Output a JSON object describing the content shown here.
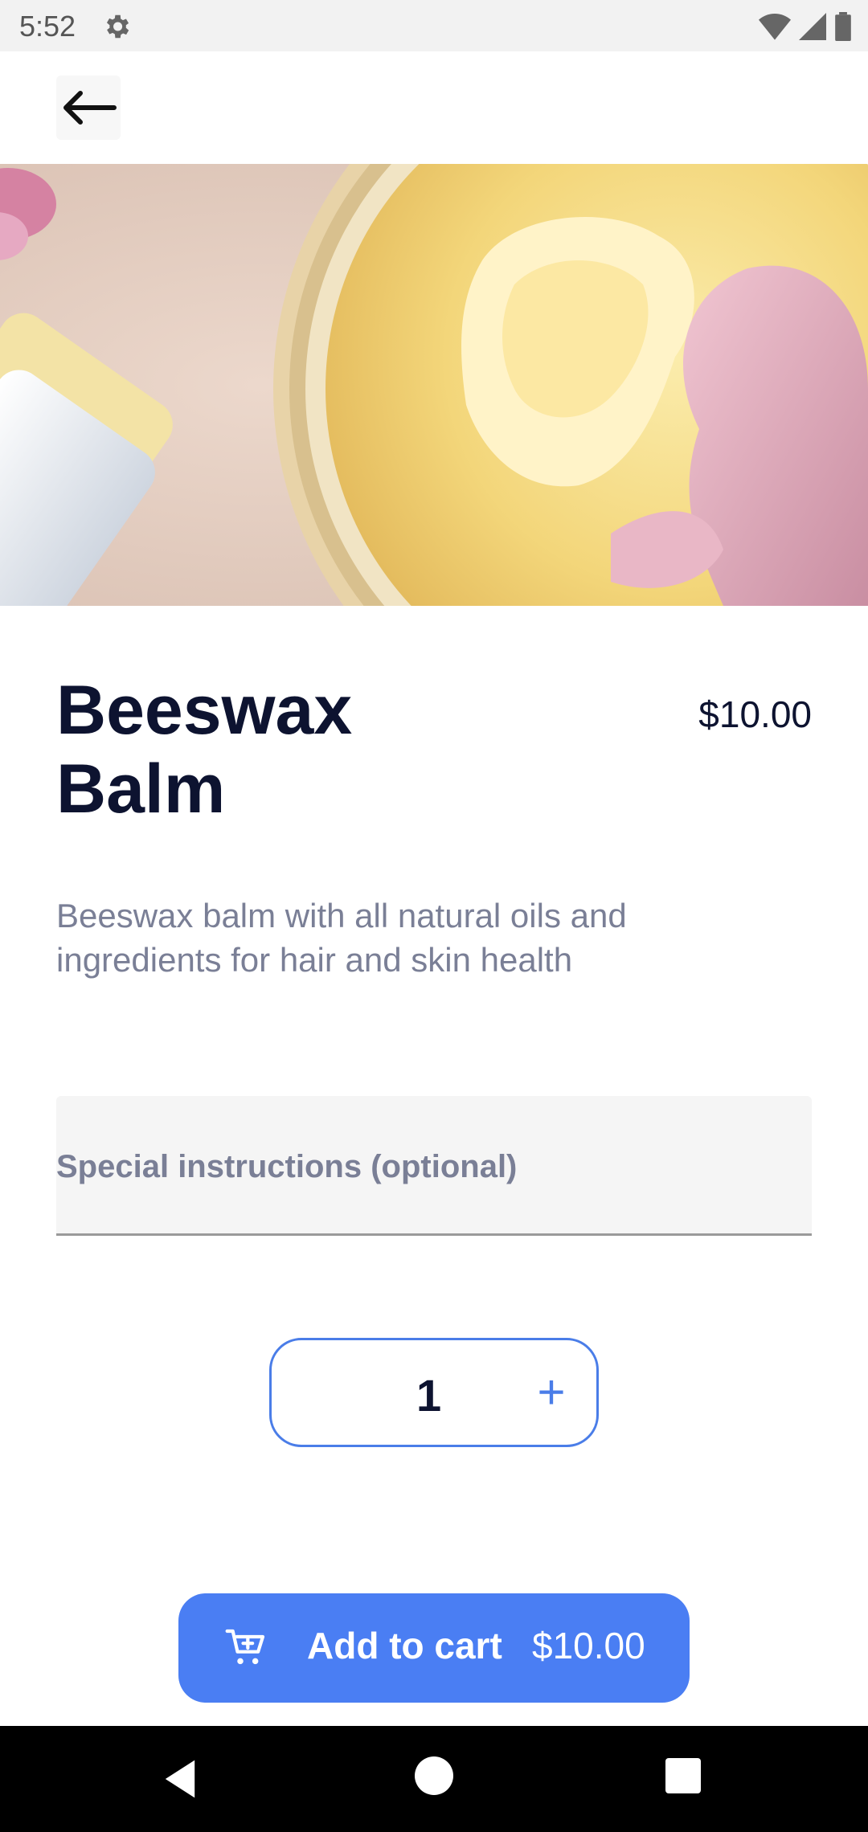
{
  "status_bar": {
    "time": "5:52",
    "icons": [
      "gear-icon",
      "wifi-icon",
      "signal-icon",
      "battery-icon"
    ]
  },
  "app_bar": {
    "back_icon": "arrow-left-icon"
  },
  "product": {
    "title": "Beeswax Balm",
    "price": "$10.00",
    "description": "Beeswax balm with all natural oils and ingredients for hair and skin health"
  },
  "instructions": {
    "placeholder": "Special instructions (optional)"
  },
  "quantity": {
    "value": "1",
    "increment_label": "+"
  },
  "cart_button": {
    "label": "Add to cart",
    "price": "$10.00",
    "icon": "cart-add-icon"
  },
  "colors": {
    "accent": "#4a7ef3",
    "title": "#0d1330",
    "muted": "#7a7f96"
  }
}
